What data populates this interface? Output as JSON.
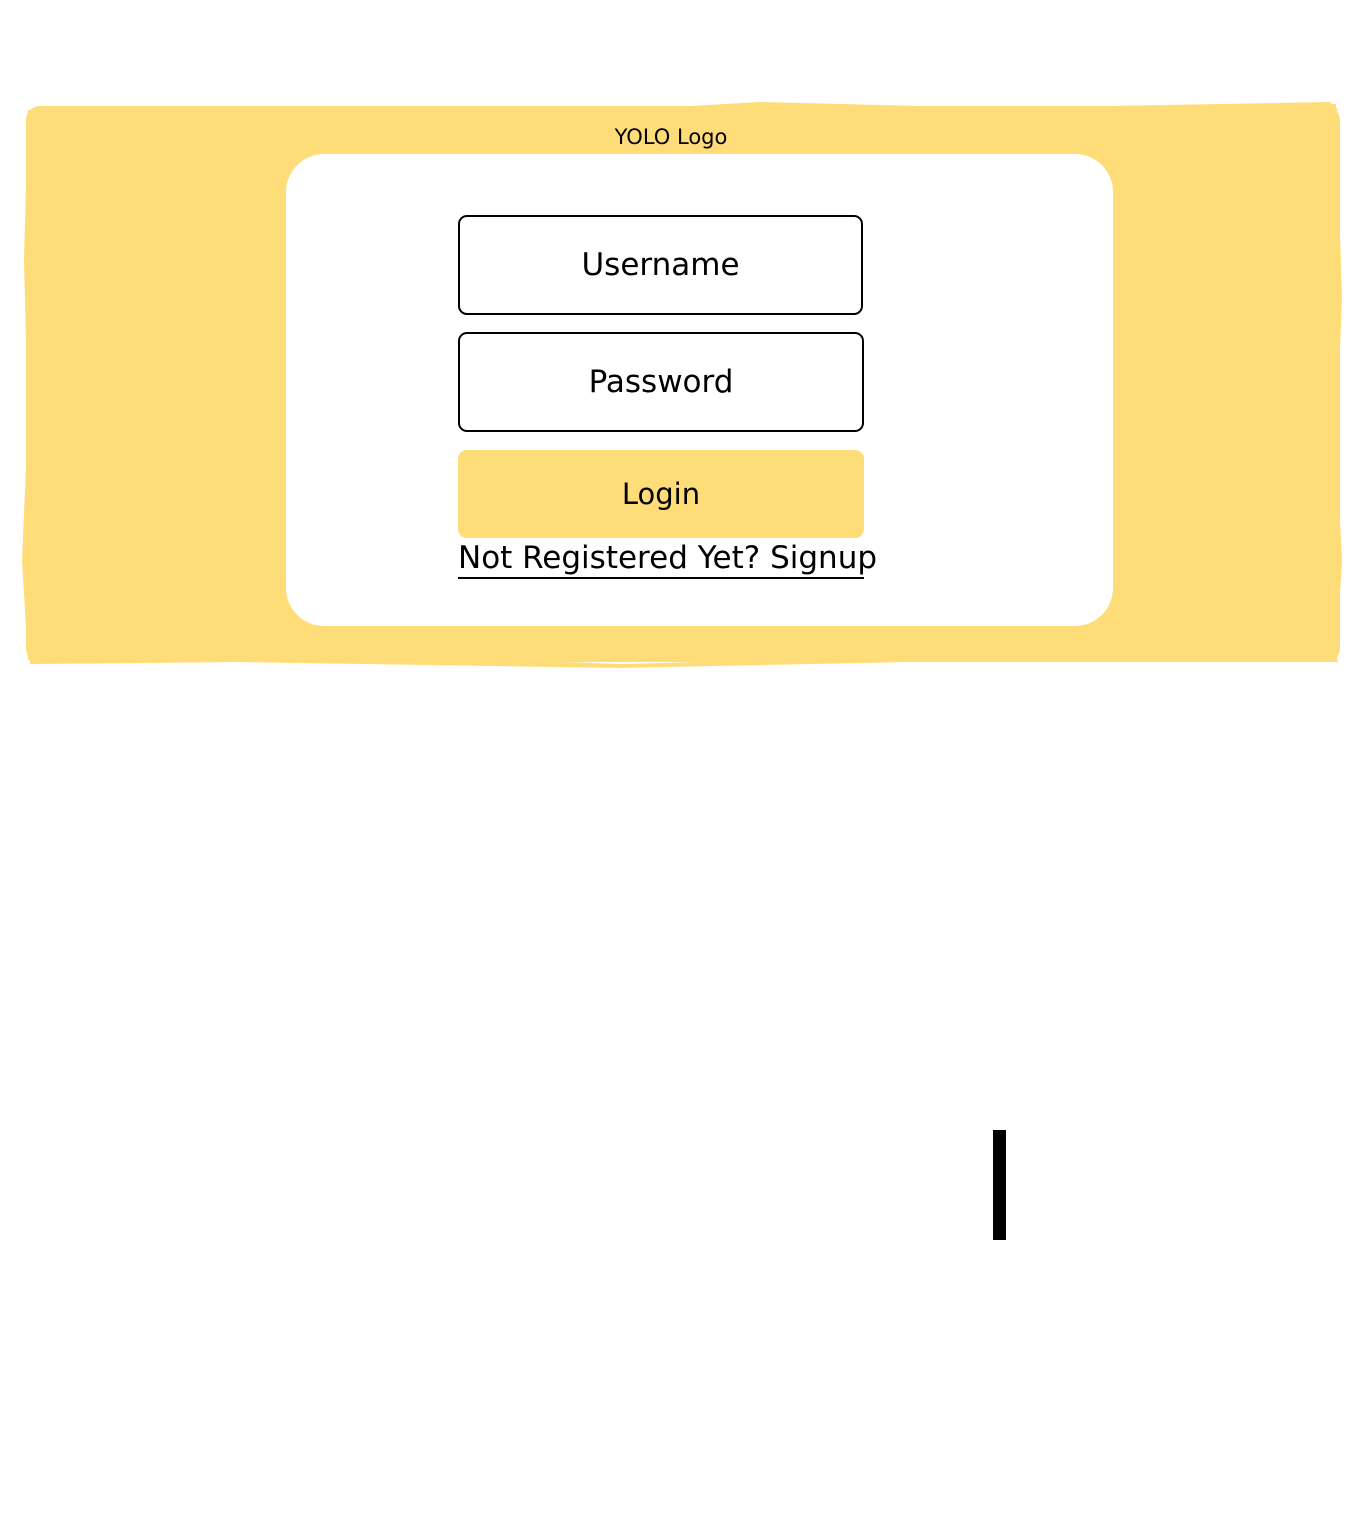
{
  "header": {
    "logo_text": "YOLO Logo"
  },
  "login_form": {
    "username_placeholder": "Username",
    "password_placeholder": "Password",
    "login_label": "Login",
    "signup_link_label": "Not Registered Yet? Signup"
  },
  "colors": {
    "accent": "#fedd78",
    "background": "#ffffff",
    "text": "#000000"
  }
}
